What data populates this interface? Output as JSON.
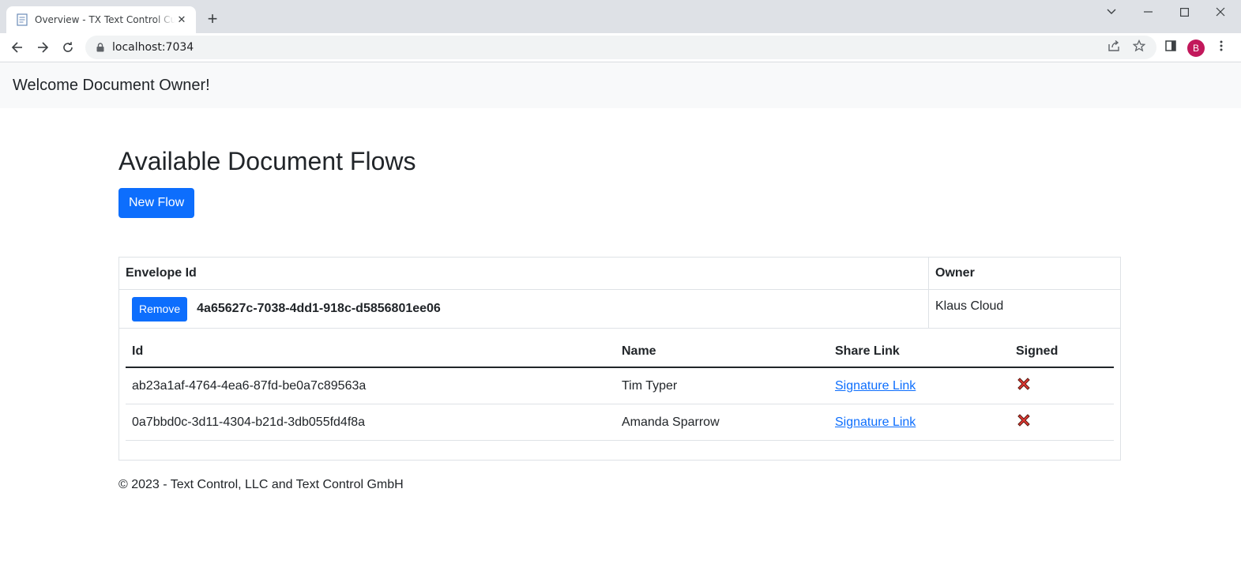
{
  "browser": {
    "tab_title": "Overview - TX Text Control Customer Portal",
    "url": "localhost:7034",
    "profile_initial": "B",
    "profile_color": "#c2185b"
  },
  "navbar": {
    "brand": "Welcome Document Owner!"
  },
  "main": {
    "title": "Available Document Flows",
    "new_flow_label": "New Flow",
    "envelope_table": {
      "headers": {
        "envelope_id": "Envelope Id",
        "owner": "Owner"
      },
      "rows": [
        {
          "remove_label": "Remove",
          "envelope_id": "4a65627c-7038-4dd1-918c-d5856801ee06",
          "owner": "Klaus Cloud",
          "signers": {
            "headers": {
              "id": "Id",
              "name": "Name",
              "share_link": "Share Link",
              "signed": "Signed"
            },
            "rows": [
              {
                "id": "ab23a1af-4764-4ea6-87fd-be0a7c89563a",
                "name": "Tim Typer",
                "share_link": "Signature Link",
                "signed_icon": "red-x-icon"
              },
              {
                "id": "0a7bbd0c-3d11-4304-b21d-3db055fd4f8a",
                "name": "Amanda Sparrow",
                "share_link": "Signature Link",
                "signed_icon": "red-x-icon"
              }
            ]
          }
        }
      ]
    }
  },
  "footer": {
    "text": "© 2023 - Text Control, LLC and Text Control GmbH"
  },
  "colors": {
    "primary": "#0d6efd",
    "navbar_bg": "#f8f9fa",
    "not_signed": "#e53935"
  }
}
